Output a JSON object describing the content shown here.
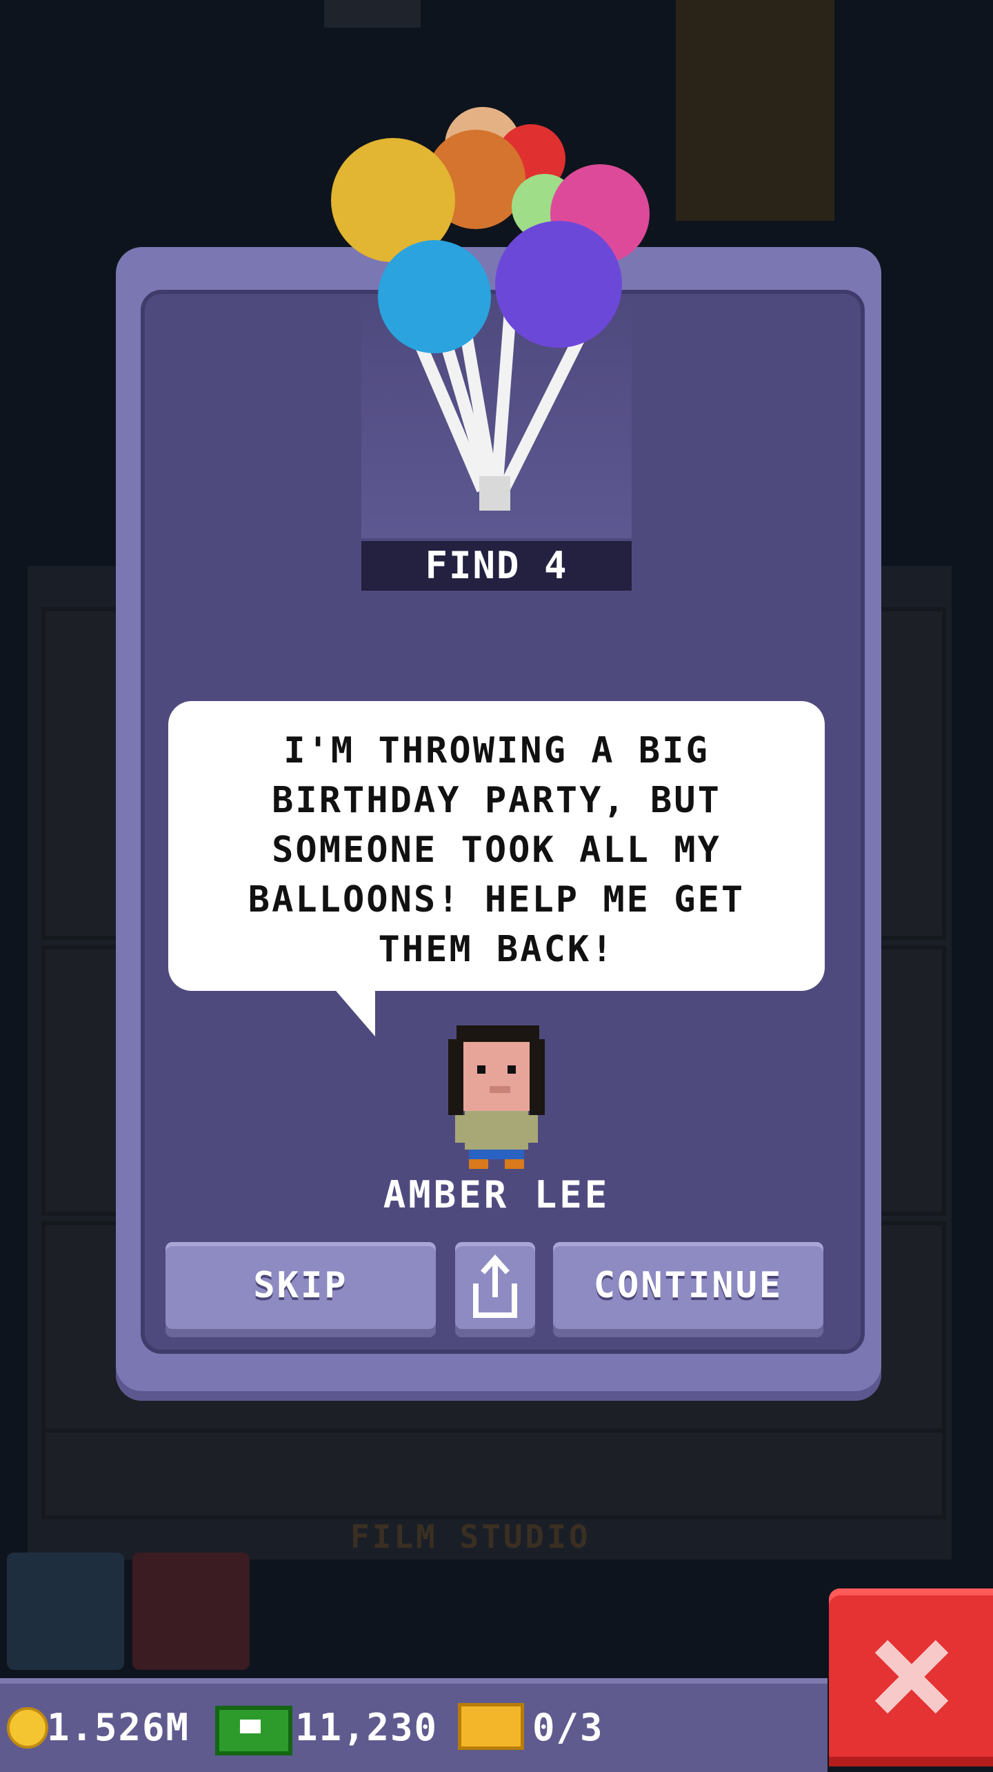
{
  "quest": {
    "find_label": "FIND 4",
    "message": "I'M THROWING A BIG\nBIRTHDAY PARTY, BUT\nSOMEONE TOOK ALL MY\nBALLOONS! HELP ME GET\nTHEM BACK!",
    "npc_name": "AMBER LEE",
    "reward_icon": "balloons-icon"
  },
  "buttons": {
    "skip": "SKIP",
    "share_icon": "share-icon",
    "continue": "CONTINUE"
  },
  "background": {
    "floor_name": "FILM STUDIO"
  },
  "hud": {
    "coins": "1.526M",
    "bux": "11,230",
    "tickets": "0/3"
  },
  "colors": {
    "dialog": "#7b77b3",
    "dialog_inner": "#4f4a7e",
    "close_button": "#e53232",
    "hud": "#5f5b8f"
  }
}
